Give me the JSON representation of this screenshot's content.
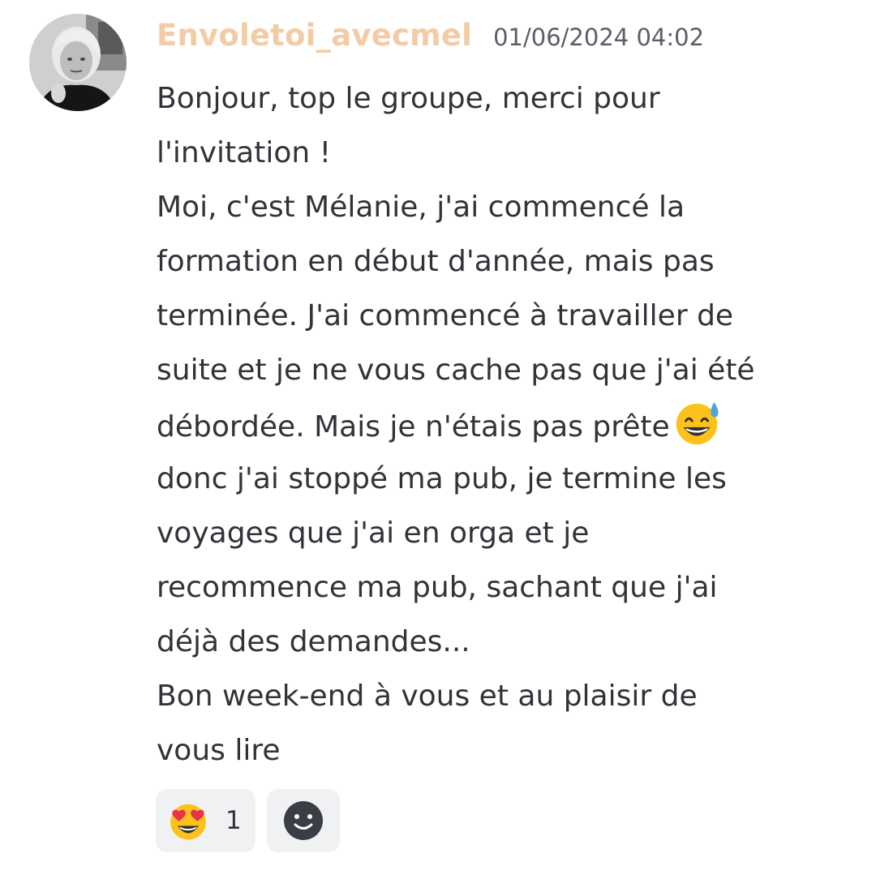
{
  "message": {
    "author": "Envoletoi_avecmel",
    "timestamp": "01/06/2024 04:02",
    "avatar": "profile-photo",
    "lines": [
      "Bonjour, top le groupe, merci pour",
      "l'invitation !",
      "Moi, c'est Mélanie, j'ai commencé la",
      "formation en début d'année, mais pas",
      "terminée. J'ai commencé à travailler de",
      "suite et je ne vous cache pas que j'ai été",
      "débordée. Mais je n'étais pas prête",
      "donc j'ai stoppé ma pub, je termine les",
      "voyages que j'ai en orga et je",
      "recommence ma pub, sachant que j'ai",
      "déjà des demandes...",
      "Bon week-end à vous et au plaisir de",
      "vous lire"
    ],
    "inline_emoji": "grinning-face-with-sweat-emoji"
  },
  "reactions": [
    {
      "emoji": "smiling-face-with-heart-eyes-emoji",
      "count": "1"
    }
  ],
  "add_reaction": {
    "icon": "add-reaction-icon"
  },
  "colors": {
    "username": "#f3cba6",
    "text": "#313338",
    "timestamp": "#5c5e66",
    "reaction_bg": "#f0f1f3"
  }
}
